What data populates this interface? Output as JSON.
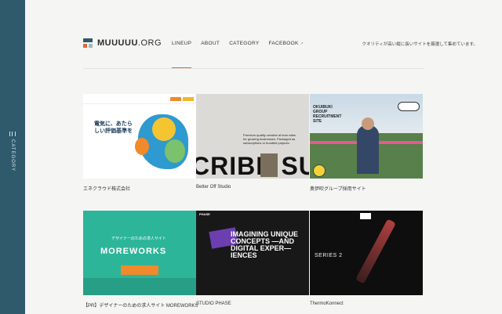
{
  "colors": {
    "sidebar": "#2f5a6b",
    "accent": "#e2663a",
    "background": "#f5f5f4"
  },
  "sidebar": {
    "label": "CATEGORY",
    "icon": "menu-lines-icon"
  },
  "site": {
    "logo_main": "MUUUUU",
    "logo_ext": ".ORG",
    "tagline": "クオリティが高い縦に長いサイトを厳選して集めています。"
  },
  "nav": {
    "items": [
      {
        "label": "LINEUP",
        "active": true
      },
      {
        "label": "ABOUT"
      },
      {
        "label": "CATEGORY"
      },
      {
        "label": "FACEBOOK",
        "icon": "external-link-icon"
      }
    ]
  },
  "cards": [
    {
      "title": "エネクラウド株式会社",
      "thumb_text": "電気に、あたらしい評価基準を"
    },
    {
      "title": "Better Off Studio",
      "thumb_text": "Premium quality creative at lean rates for growing businesses. Packaged as subscriptions or bundled projects.",
      "thumb_big": "CRIBE SU"
    },
    {
      "title": "奥伊吹グループ採用サイト",
      "thumb_text": "OKUIBUKI GROUP RECRUITMENT SITE"
    },
    {
      "title": "【PR】デザイナーのための求人サイト MOREWORKS",
      "thumb_sub": "デザイナーのための求人サイト",
      "thumb_logo": "MOREWORKS"
    },
    {
      "title": "STUDIO PHASE",
      "thumb_header": "PHASE",
      "thumb_text": "IMAGINING UNIQUE CONCEPTS —AND DIGITAL EXPER— IENCES"
    },
    {
      "title": "ThermoKonnect",
      "thumb_text": "SERIES 2"
    }
  ]
}
